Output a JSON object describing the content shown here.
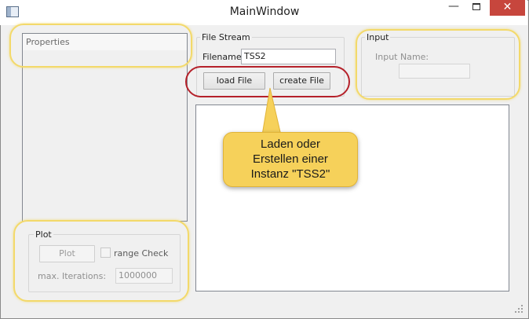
{
  "window": {
    "title": "MainWindow"
  },
  "properties": {
    "header": "Properties"
  },
  "file_stream": {
    "group_label": "File Stream",
    "filename_label": "Filename:",
    "filename_value": "TSS2",
    "load_button": "load File",
    "create_button": "create File"
  },
  "input": {
    "group_label": "Input",
    "name_label": "Input Name:",
    "name_value": ""
  },
  "plot": {
    "group_label": "Plot",
    "plot_button": "Plot",
    "range_check_label": "range Check",
    "max_iterations_label": "max. Iterations:",
    "max_iterations_value": "1000000"
  },
  "callout": {
    "text": "Laden oder\nErstellen einer\nInstanz \"TSS2\""
  },
  "colors": {
    "highlight_yellow": "#f3d96a",
    "highlight_red": "#b5212a",
    "callout_fill": "#f6d15a",
    "close_button": "#c7463d"
  },
  "icons": {
    "app": "app-window-icon",
    "minimize": "minimize-icon",
    "maximize": "maximize-icon",
    "close": "close-icon",
    "resize": "resize-grip-icon"
  }
}
